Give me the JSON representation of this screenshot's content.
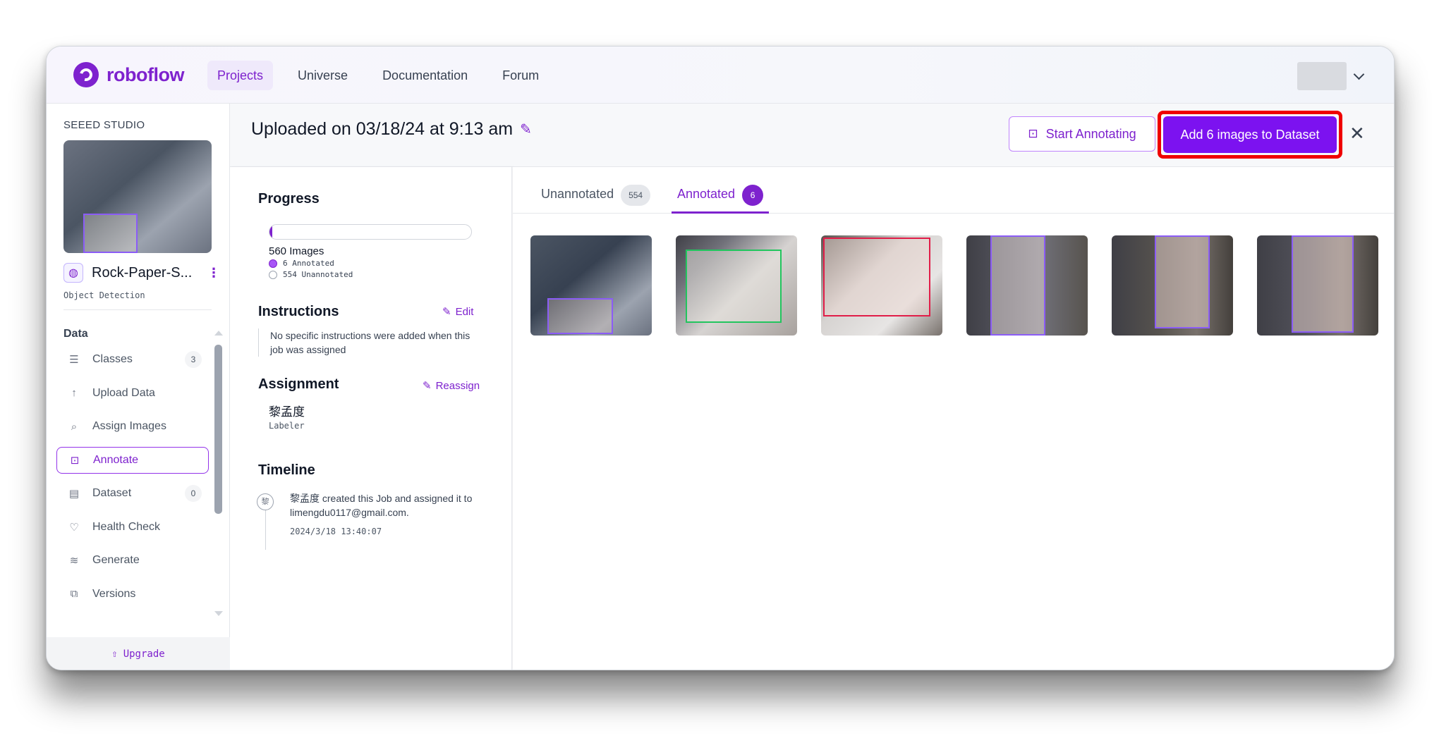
{
  "nav": {
    "logo": "roboflow",
    "links": [
      "Projects",
      "Universe",
      "Documentation",
      "Forum"
    ],
    "active_link": "Projects"
  },
  "sidebar": {
    "workspace": "SEEED STUDIO",
    "project_name": "Rock-Paper-S...",
    "project_type": "Object Detection",
    "section_label": "Data",
    "items": [
      {
        "label": "Classes",
        "icon": "list-icon",
        "count": "3"
      },
      {
        "label": "Upload Data",
        "icon": "upload-arrow-icon",
        "count": ""
      },
      {
        "label": "Assign Images",
        "icon": "search-icon",
        "count": ""
      },
      {
        "label": "Annotate",
        "icon": "annotate-icon",
        "count": "",
        "active": true
      },
      {
        "label": "Dataset",
        "icon": "images-icon",
        "count": "0"
      },
      {
        "label": "Health Check",
        "icon": "heart-icon",
        "count": ""
      },
      {
        "label": "Generate",
        "icon": "layers-icon",
        "count": ""
      },
      {
        "label": "Versions",
        "icon": "versions-icon",
        "count": ""
      }
    ],
    "upgrade": "Upgrade"
  },
  "header": {
    "title": "Uploaded on 03/18/24 at 9:13 am",
    "start_annotating": "Start Annotating",
    "add_to_dataset": "Add 6 images to Dataset"
  },
  "panel": {
    "progress_heading": "Progress",
    "progress_fraction": 0.0107,
    "total_images": "560 Images",
    "annotated_legend": "6 Annotated",
    "unannotated_legend": "554 Unannotated",
    "instructions_heading": "Instructions",
    "edit_label": "Edit",
    "instructions_text": "No specific instructions were added when this job was assigned",
    "assignment_heading": "Assignment",
    "reassign_label": "Reassign",
    "assignee": "黎孟度",
    "assignee_role": "Labeler",
    "timeline_heading": "Timeline",
    "timeline_avatar": "黎",
    "timeline_text": "黎孟度 created this Job and assigned it to limengdu0117@gmail.com.",
    "timeline_date": "2024/3/18 13:40:07"
  },
  "tabs": {
    "unannotated_label": "Unannotated",
    "unannotated_count": "554",
    "annotated_label": "Annotated",
    "annotated_count": "6"
  },
  "colors": {
    "brand": "#7e22ce",
    "highlight": "#ef0000",
    "cta": "#7c12f0"
  }
}
